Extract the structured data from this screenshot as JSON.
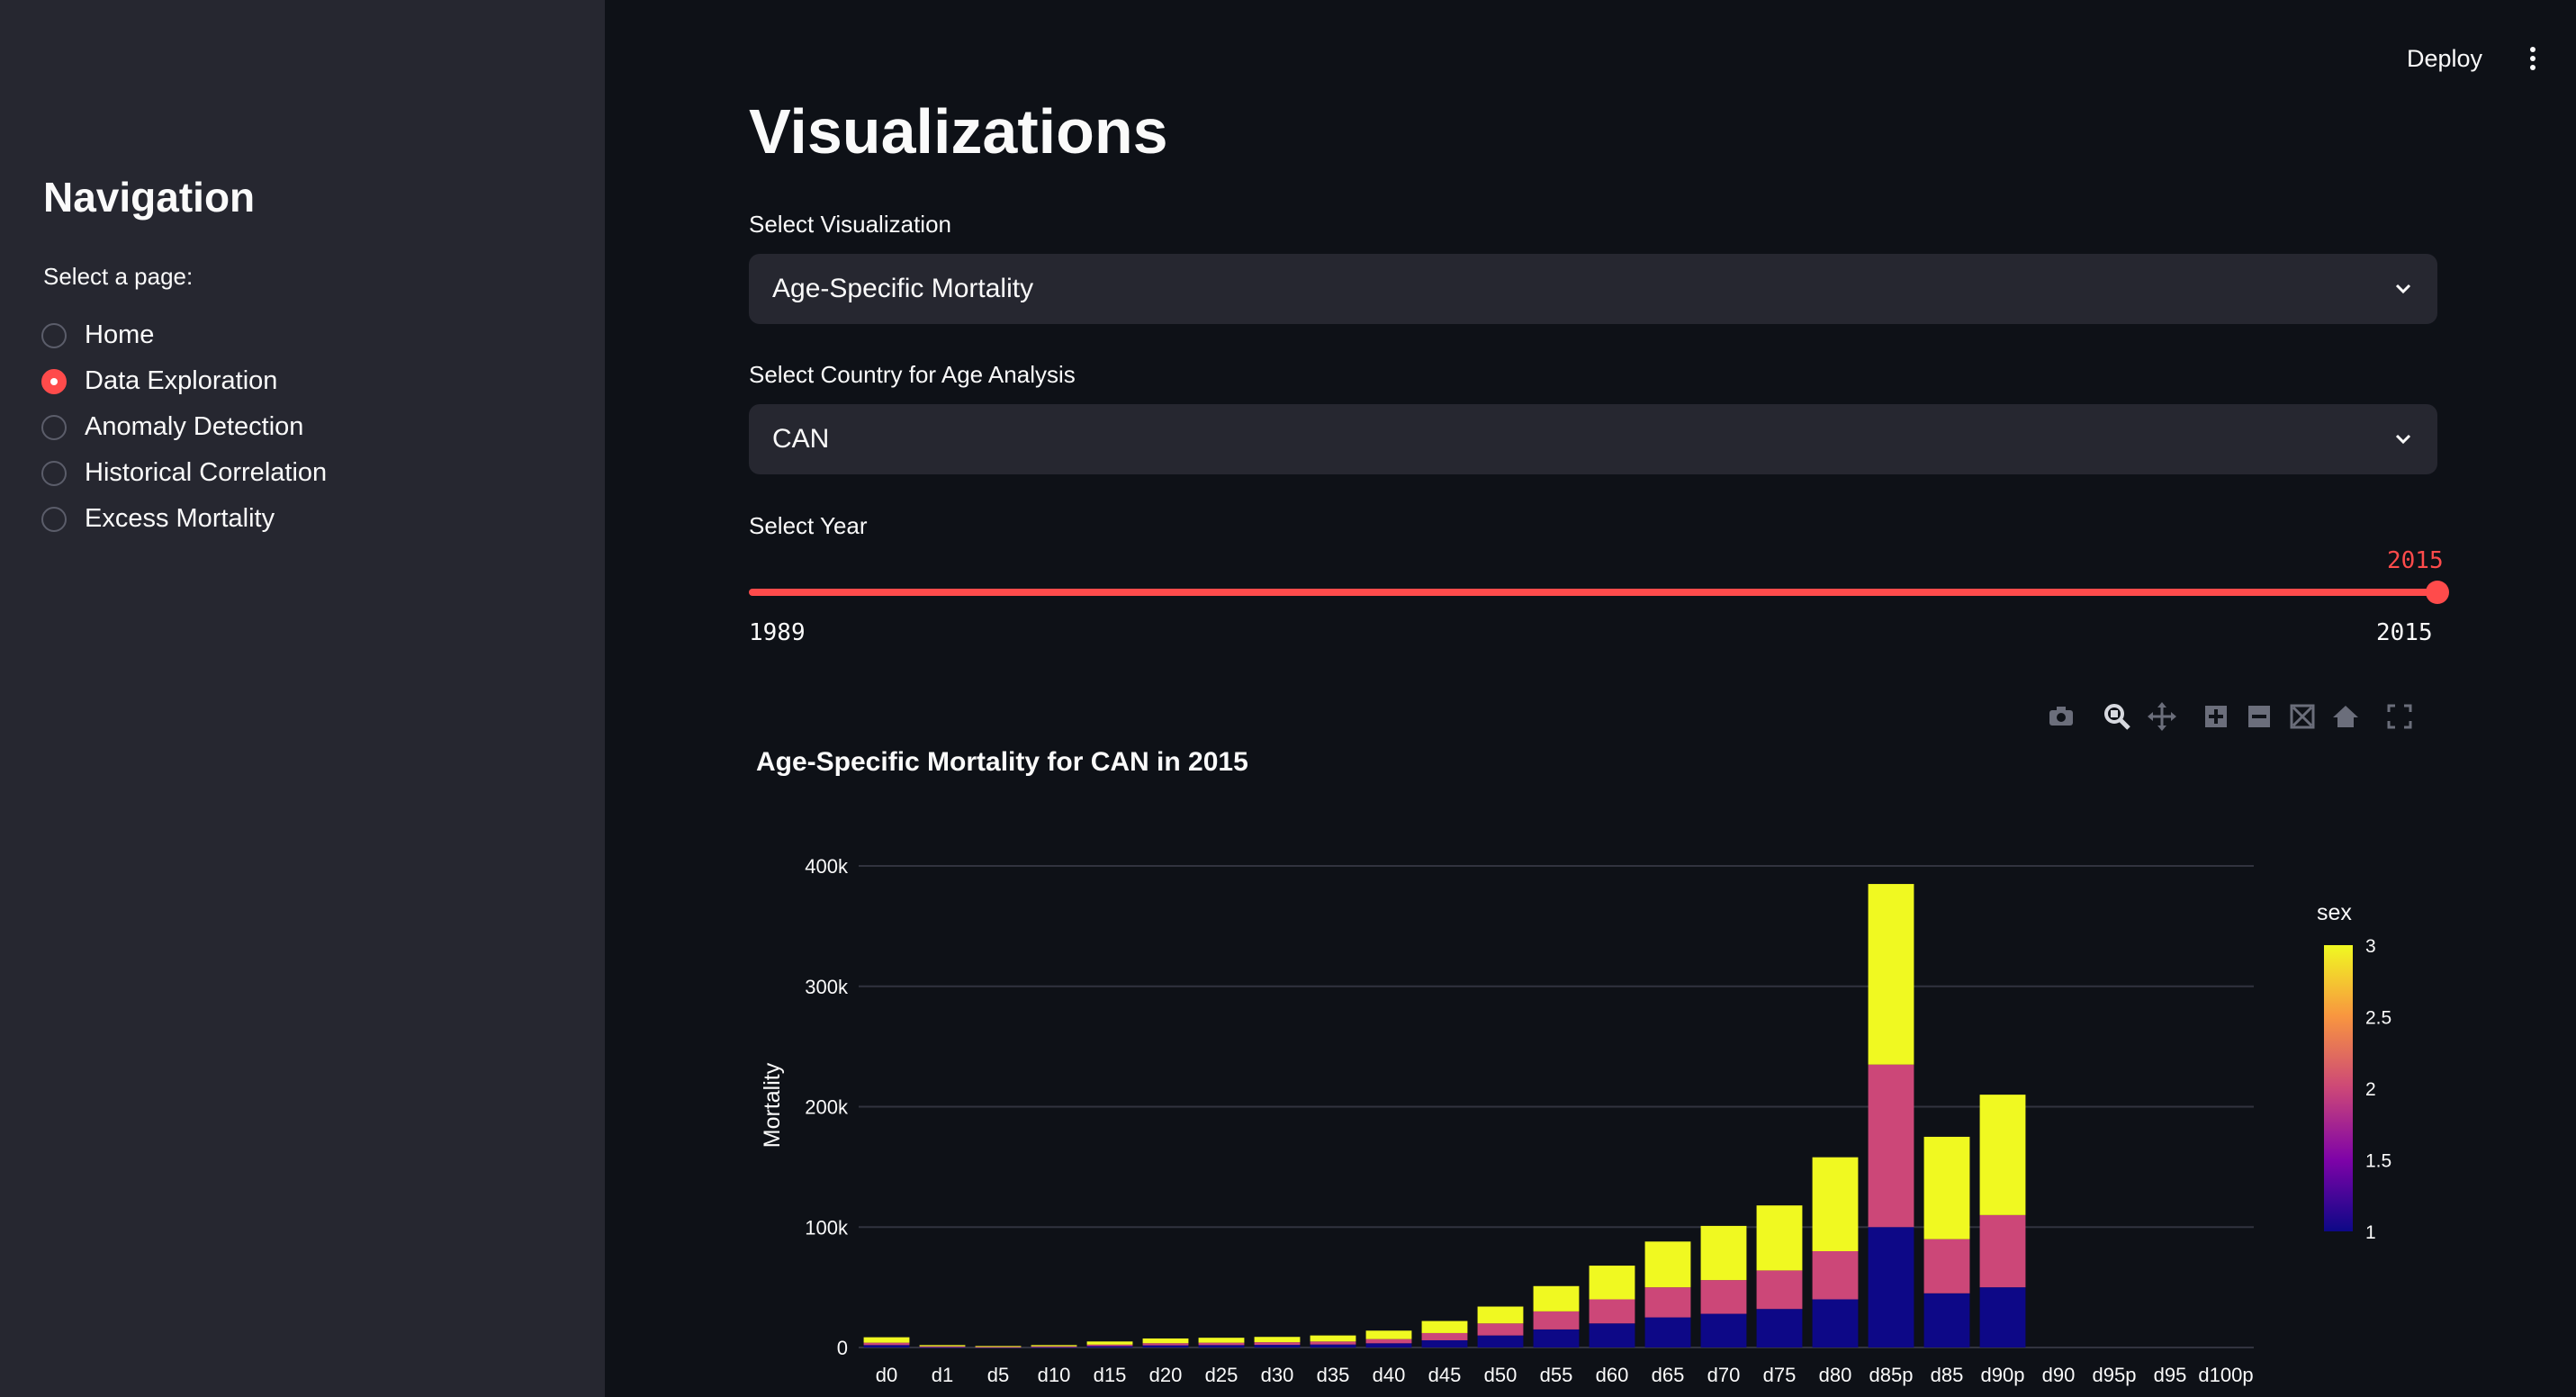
{
  "sidebar": {
    "title": "Navigation",
    "select_label": "Select a page:",
    "pages": [
      {
        "label": "Home",
        "selected": false
      },
      {
        "label": "Data Exploration",
        "selected": true
      },
      {
        "label": "Anomaly Detection",
        "selected": false
      },
      {
        "label": "Historical Correlation",
        "selected": false
      },
      {
        "label": "Excess Mortality",
        "selected": false
      }
    ]
  },
  "header": {
    "deploy_label": "Deploy",
    "menu_icon": "kebab-menu-icon"
  },
  "main": {
    "title": "Visualizations",
    "viz_select": {
      "label": "Select Visualization",
      "value": "Age-Specific Mortality"
    },
    "country_select": {
      "label": "Select Country for Age Analysis",
      "value": "CAN"
    },
    "year_slider": {
      "label": "Select Year",
      "value": "2015",
      "min": "1989",
      "max": "2015",
      "fraction": 1.0
    }
  },
  "modebar_icons": [
    "camera-icon",
    "zoom-icon",
    "pan-icon",
    "zoom-in-icon",
    "zoom-out-icon",
    "autoscale-icon",
    "reset-axes-icon",
    "fullscreen-icon"
  ],
  "colors": {
    "accent": "#ff4b4b",
    "sidebar_bg": "#262730",
    "app_bg": "#0e1117"
  },
  "chart_data": {
    "type": "bar",
    "barmode": "stack",
    "title": "Age-Specific Mortality for CAN in 2015",
    "xlabel": "",
    "ylabel": "Mortality",
    "yticks": [
      0,
      100000,
      200000,
      300000,
      400000
    ],
    "ytick_labels": [
      "0",
      "100k",
      "200k",
      "300k",
      "400k"
    ],
    "ylim": [
      0,
      400000
    ],
    "categories": [
      "d0",
      "d1",
      "d5",
      "d10",
      "d15",
      "d20",
      "d25",
      "d30",
      "d35",
      "d40",
      "d45",
      "d50",
      "d55",
      "d60",
      "d65",
      "d70",
      "d75",
      "d80",
      "d85p",
      "d85",
      "d90p",
      "d90",
      "d95p",
      "d95",
      "d100p"
    ],
    "series": [
      {
        "values": [
          2000,
          500,
          300,
          500,
          1200,
          1800,
          2000,
          2200,
          2500,
          3500,
          6000,
          10000,
          15000,
          20000,
          25000,
          28000,
          32000,
          40000,
          100000,
          45000,
          50000,
          0,
          0,
          0,
          0
        ]
      },
      {
        "values": [
          2000,
          500,
          300,
          500,
          1200,
          1800,
          2000,
          2200,
          2500,
          3500,
          6000,
          10000,
          15000,
          20000,
          25000,
          28000,
          32000,
          40000,
          135000,
          45000,
          60000,
          0,
          0,
          0,
          0
        ]
      },
      {
        "values": [
          4500,
          1000,
          600,
          1000,
          2600,
          3900,
          4100,
          4400,
          5000,
          7000,
          10000,
          14000,
          21000,
          28000,
          38000,
          45000,
          54000,
          78000,
          150000,
          85000,
          100000,
          0,
          0,
          0,
          0
        ]
      }
    ],
    "colorbar": {
      "title": "sex",
      "ticks": [
        "1",
        "1.5",
        "2",
        "2.5",
        "3"
      ],
      "range": [
        1,
        3
      ]
    },
    "grid": true
  }
}
